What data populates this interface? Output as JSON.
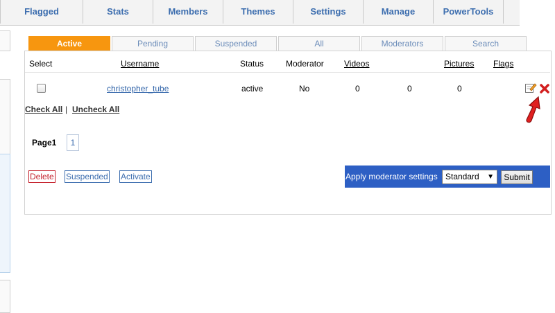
{
  "topnav": {
    "tabs": [
      "Flagged",
      "Stats",
      "Members",
      "Themes",
      "Settings",
      "Manage",
      "PowerTools"
    ]
  },
  "subtabs": [
    "Active",
    "Pending",
    "Suspended",
    "All",
    "Moderators",
    "Search"
  ],
  "table": {
    "headers": [
      "Select",
      "Username",
      "Status",
      "Moderator",
      "Videos",
      "Pictures",
      "Flags"
    ],
    "rows": [
      {
        "username": "christopher_tube",
        "status": "active",
        "moderator": "No",
        "videos": "0",
        "col6": "0",
        "pictures": "0"
      }
    ]
  },
  "selection": {
    "check_all": "Check All",
    "separator": "|",
    "uncheck_all": "Uncheck All"
  },
  "pagination": {
    "label": "Page1",
    "pages": [
      "1"
    ]
  },
  "actions": {
    "delete": "Delete",
    "suspended": "Suspended",
    "activate": "Activate"
  },
  "moderator_settings": {
    "label": "Apply moderator settings",
    "selected": "Standard",
    "submit": "Submit"
  },
  "icons": {
    "edit": "edit-icon",
    "delete": "delete-x-icon",
    "pointer": "red-arrow-pointer-icon"
  },
  "colors": {
    "accent": "#f7960f",
    "link": "#3d6eaf",
    "bar": "#2d5fc4",
    "danger": "#c41f2a"
  }
}
